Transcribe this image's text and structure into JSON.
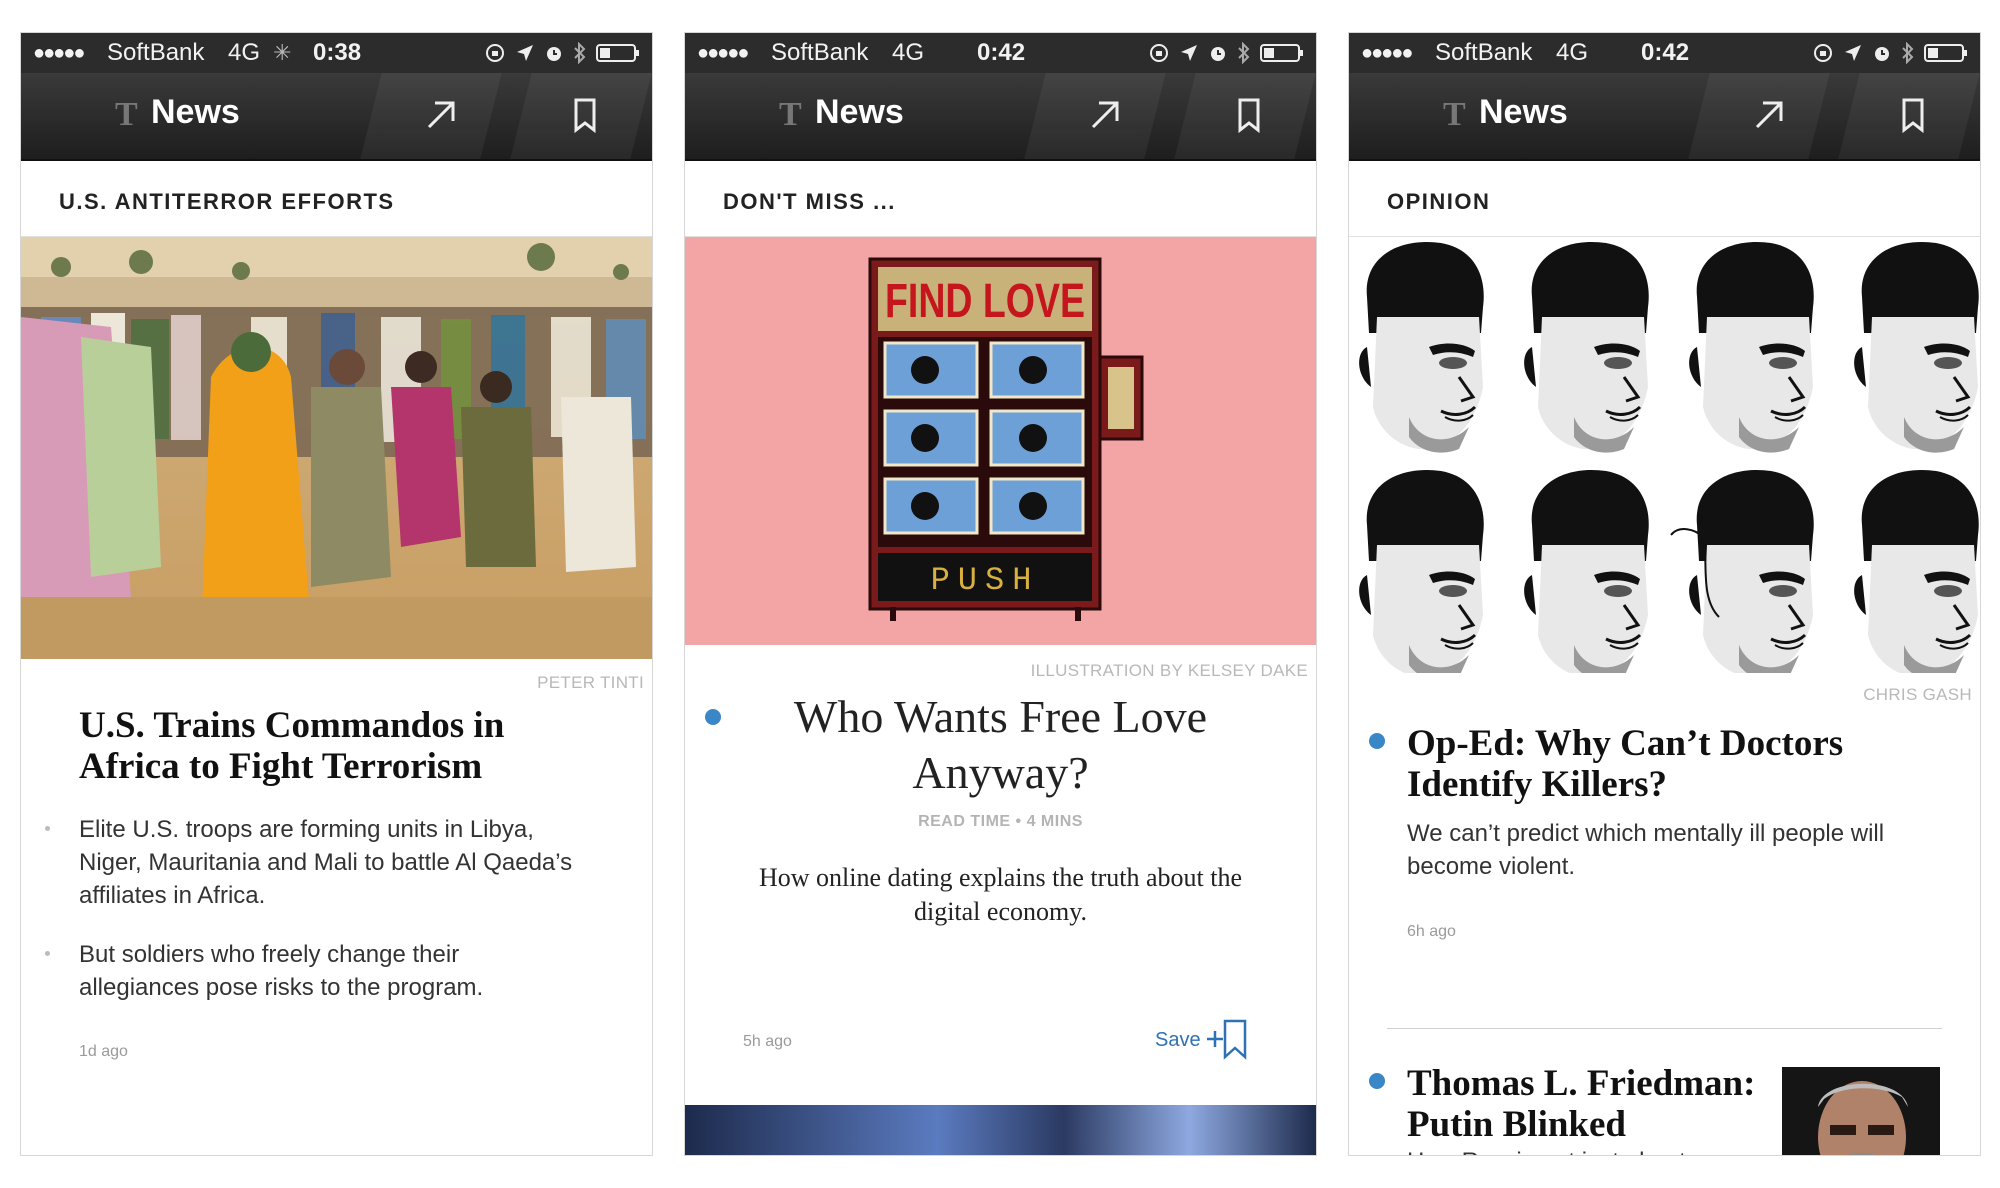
{
  "screens": [
    {
      "status": {
        "dots": "●●●●●",
        "carrier": "SoftBank",
        "network": "4G",
        "time": "0:38"
      },
      "nav": {
        "title": "News"
      },
      "section": "U.S. ANTITERROR EFFORTS",
      "credit": "PETER TINTI",
      "headline": "U.S. Trains Commandos in Africa to Fight Terrorism",
      "bullets": [
        "Elite U.S. troops are forming units in Libya, Niger, Mauritania and Mali to battle Al Qaeda’s affiliates in Africa.",
        "But soldiers who freely change their allegiances pose risks to the program."
      ],
      "time_ago": "1d ago"
    },
    {
      "status": {
        "dots": "●●●●●",
        "carrier": "SoftBank",
        "network": "4G",
        "time": "0:42"
      },
      "nav": {
        "title": "News"
      },
      "section": "DON'T MISS ...",
      "illustration": {
        "sign": "FIND LOVE",
        "push": "PUSH"
      },
      "credit": "ILLUSTRATION BY KELSEY DAKE",
      "headline": "Who Wants Free Love Anyway?",
      "readtime": "READ TIME • 4 MINS",
      "summary": "How online dating explains the truth about the digital economy.",
      "time_ago": "5h ago",
      "save_label": "Save"
    },
    {
      "status": {
        "dots": "●●●●●",
        "carrier": "SoftBank",
        "network": "4G",
        "time": "0:42"
      },
      "nav": {
        "title": "News"
      },
      "section": "OPINION",
      "credit": "CHRIS GASH",
      "headline": "Op-Ed: Why Can’t Doctors Identify Killers?",
      "summary": "We can’t predict which mentally ill people will become violent.",
      "time_ago": "6h ago",
      "headline2": "Thomas L. Friedman: Putin Blinked",
      "summary2": "How Russia got just about"
    }
  ],
  "colors": {
    "accent_blue": "#3a87c8",
    "save_blue": "#2f72b4",
    "pink_bg": "#f3a5a5",
    "nav_dark": "#2c2c2c"
  },
  "icons": [
    "nyt-logo-icon",
    "share-arrow-icon",
    "bookmark-icon",
    "orientation-lock-icon",
    "location-arrow-icon",
    "alarm-icon",
    "bluetooth-icon",
    "battery-icon",
    "save-bookmark-icon"
  ]
}
